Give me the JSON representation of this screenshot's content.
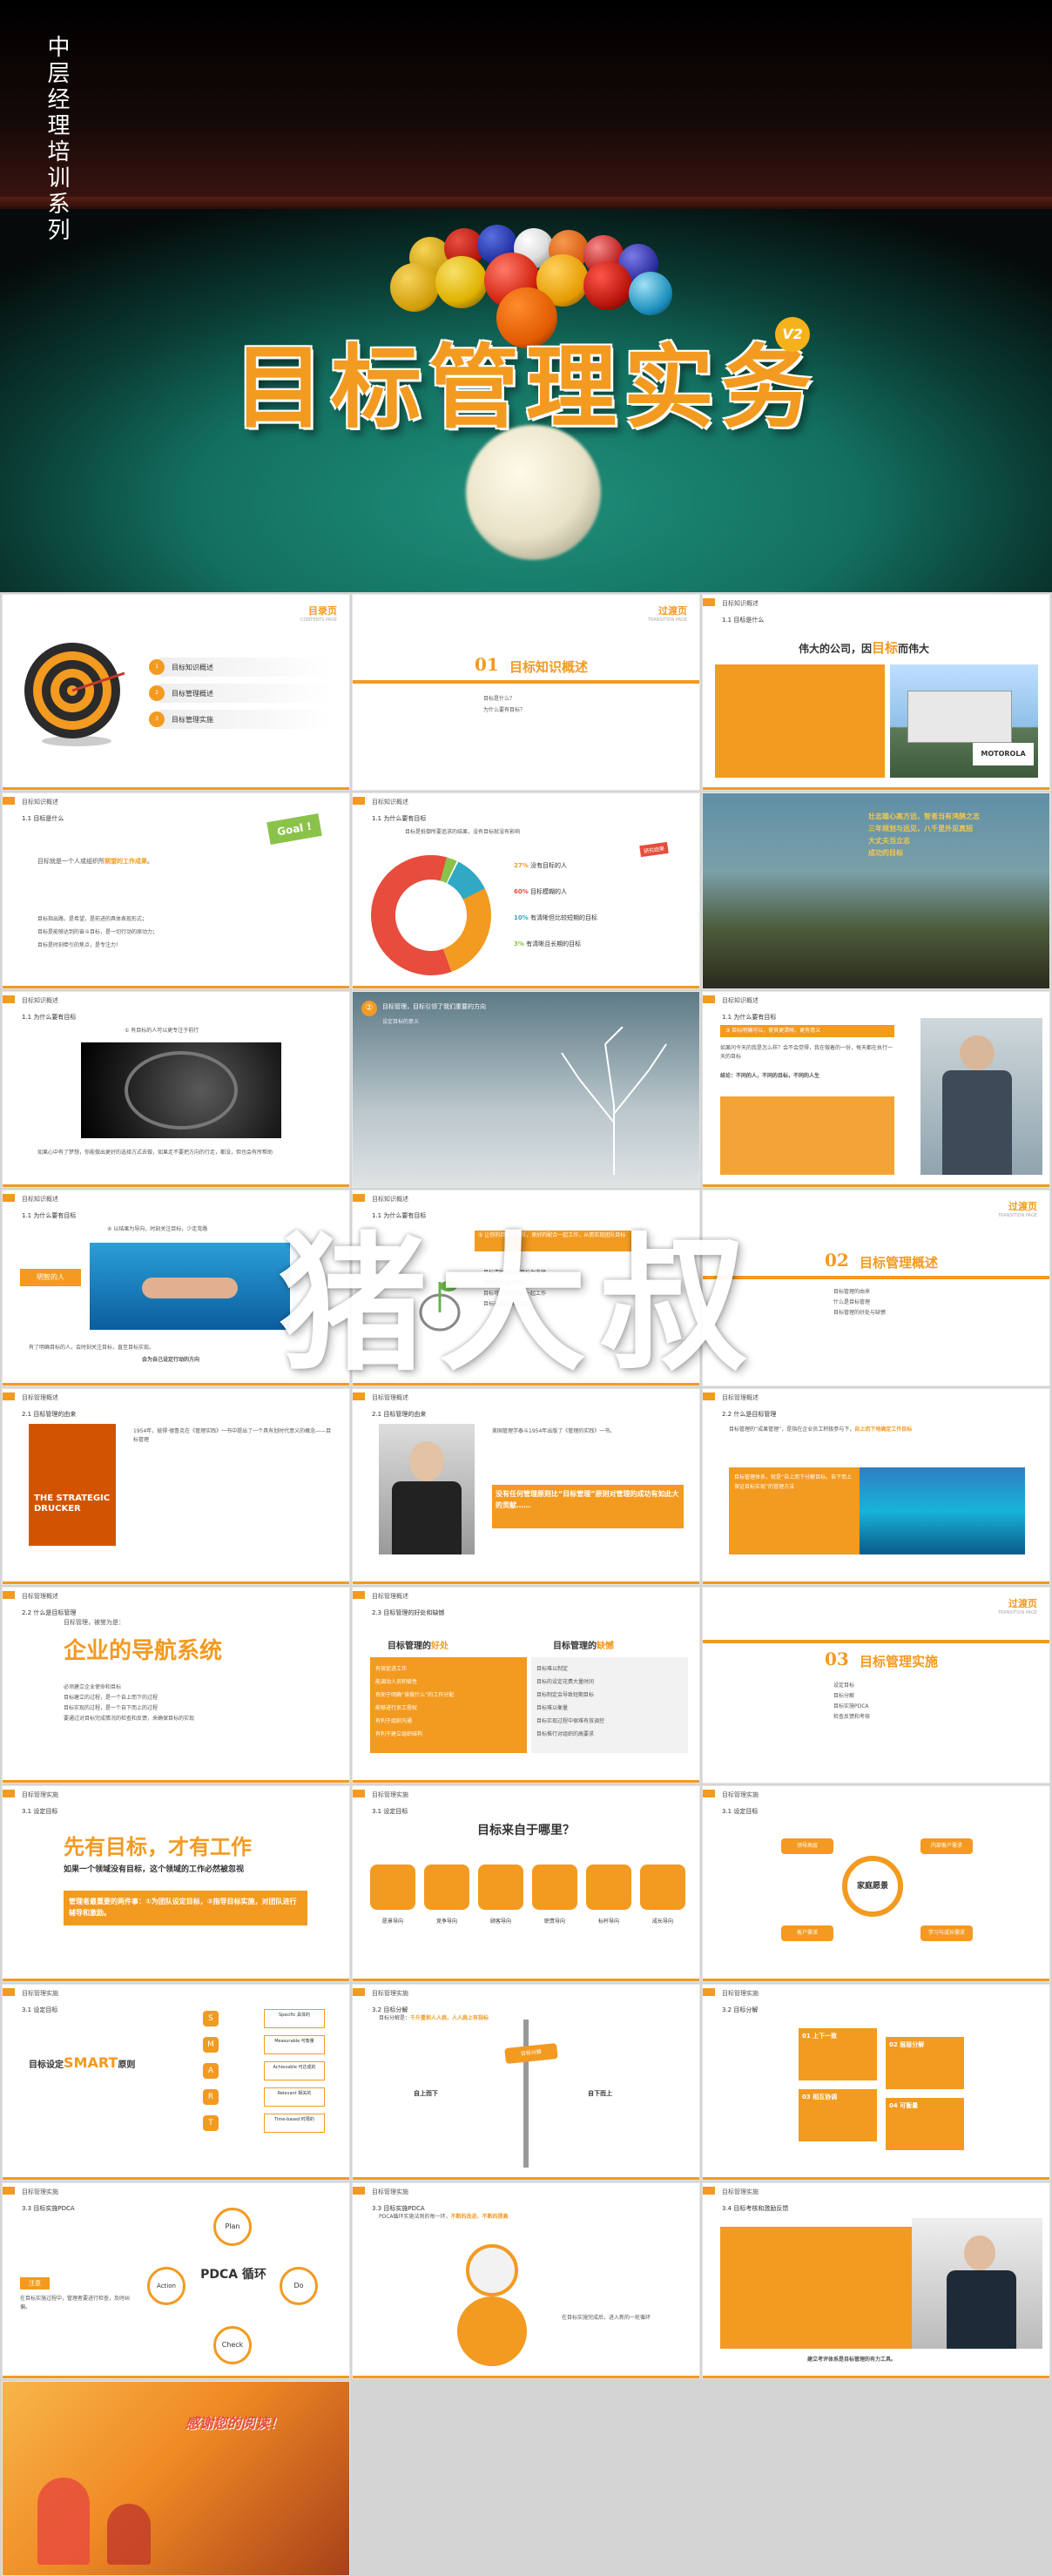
{
  "cover": {
    "series": "中层经理培训系列",
    "title": "目标管理实务",
    "badge": "V2"
  },
  "watermark": "猪大叔",
  "s1": {
    "title": "目录页",
    "subtitle": "CONTENTS PAGE",
    "items": [
      "目标知识概述",
      "目标管理概述",
      "目标管理实施"
    ],
    "nums": [
      "1",
      "2",
      "3"
    ]
  },
  "s2": {
    "title": "过渡页",
    "subtitle": "TRANSITION PAGE",
    "num": "01",
    "sec": "目标知识概述",
    "bullets": [
      "目标是什么？",
      "为什么要有目标？"
    ]
  },
  "s3": {
    "hd": "目标知识概述",
    "sub": "1.1 目标是什么",
    "headline": "伟大的公司，因",
    "hl_orange": "目标",
    "hl_end": "而伟大",
    "brand": "MOTOROLA"
  },
  "s4": {
    "hd": "目标知识概述",
    "sub": "1.1 目标是什么",
    "goal": "Goal !",
    "p1": "目标就是一个人或组织所",
    "p1o": "期望的工作成果",
    "p1e": "。",
    "items": [
      "目标指出路，是希望，是前进的具体表现形式；",
      "目标是能够达到的奋斗目标，是一切行动的原动力；",
      "目标是时刻牵引的焦点，是专注力！"
    ]
  },
  "s5": {
    "hd": "目标知识概述",
    "sub": "1.1 为什么要有目标",
    "q": "目标是抵御所要追求的结果，没有目标就没有影响",
    "tag": "研究结果",
    "pcts": [
      {
        "v": "27%",
        "t": "没有目标的人"
      },
      {
        "v": "60%",
        "t": "目标模糊的人"
      },
      {
        "v": "10%",
        "t": "有清晰但比较短期的目标"
      },
      {
        "v": "3%",
        "t": "有清晰且长期的目标"
      }
    ],
    "pie_labels": [
      "27%",
      "60%",
      "10%",
      "3%"
    ]
  },
  "s6": {
    "lines": [
      "壮志雄心高方远，智者当有鸿鹄之志",
      "三年规划与远见，八千里外见真招",
      "大丈夫当立志",
      "成功的目标"
    ]
  },
  "s7": {
    "hd": "目标知识概述",
    "sub": "1.1 为什么要有目标",
    "q": "① 有目标的人可以更专注于前行",
    "cap": "如果心中有了梦想，你能做出更好的选择方式去做，如果走不要把方向的行走，都没，但也会有所帮助"
  },
  "s8": {
    "num": "②",
    "head": "目标管理，目标引领了我们重要的方向",
    "sub": "设定目标的意义"
  },
  "s9": {
    "hd": "目标知识概述",
    "sub": "1.1 为什么要有目标",
    "q": "③ 目标明确可以，使其更清晰，更有意义",
    "p": "如果问今天的我是怎么样？会不会觉得，我在做着的一份，每天都在执行一天的目标",
    "o": "结论：不同的人，不同的目标，不同的人生"
  },
  "s10": {
    "hd": "目标知识概述",
    "sub": "1.1 为什么要有目标",
    "q": "④ 以结果为导向，时刻关注目标，少走弯路",
    "tag": "明智的人",
    "cap": "有了明确目标的人，会时刻关注目标，直至目标实现。",
    "co": "会为自己设定行动的方向"
  },
  "s11": {
    "hd": "目标知识概述",
    "sub": "1.1 为什么要有目标",
    "q": "⑤ 让你的目标与团队，更好的配合一起工作，从而实现团队目标",
    "items": [
      "目标清晰可以以目标为准绳",
      "目标可以调控绩效",
      "目标可以帮助团队一起工作",
      "目标达成团队满意度"
    ]
  },
  "s12": {
    "title": "过渡页",
    "subtitle": "TRANSITION PAGE",
    "num": "02",
    "sec": "目标管理概述",
    "bullets": [
      "目标管理的由来",
      "什么是目标管理",
      "目标管理的好处与缺憾"
    ]
  },
  "s13": {
    "hd": "目标管理概述",
    "sub": "2.1 目标管理的由来",
    "book": "THE STRATEGIC DRUCKER",
    "p": "1954年，彼得·德鲁克在《管理实践》一书中提出了一个具有划时代意义的概念——目标管理"
  },
  "s14": {
    "hd": "目标管理概述",
    "sub": "2.1 目标管理的由来",
    "p": "美国管理学泰斗1954年出版了《管理的实践》一书。",
    "o": "没有任何管理原则比“目标管理”原则对管理的成功有如此大的贡献……"
  },
  "s15": {
    "hd": "目标管理概述",
    "sub": "2.2 什么是目标管理",
    "p": "目标管理的“成果管理”，是指在企业员工积极参与下，",
    "o": "自上而下地确定工作目标",
    "box": "目标管理体系，就是“自上而下分解目标，自下而上保证目标实现”的管理方法"
  },
  "s16": {
    "hd": "目标管理概述",
    "sub": "2.2 什么是目标管理",
    "lead": "目标管理，被誉为是：",
    "big": "企业的导航系统",
    "items": [
      "必须建立企业使命和目标",
      "目标建立的过程，是一个自上而下的过程",
      "目标实现的过程，是一个自下而上的过程",
      "要通过对目标完成情况的检查和反馈，来确保目标的实现"
    ]
  },
  "s17": {
    "hd": "目标管理概述",
    "sub": "2.3 目标管理的好处和缺憾",
    "left": "目标管理的",
    "lo": "好处",
    "right": "目标管理的",
    "ro": "缺憾",
    "pros": [
      "有效促进工作",
      "能调动人员积极性",
      "有助于明确“谁做什么”的工作分配",
      "能够进行员工授权",
      "有利于组织沟通",
      "有利于建立组织结构"
    ],
    "cons": [
      "目标难以制定",
      "目标的设定花费大量时间",
      "目标制定会导致短期目标",
      "目标难以衡量",
      "目标实现过程中很难有效调控",
      "目标推行对组织的高要求"
    ]
  },
  "s18": {
    "title": "过渡页",
    "subtitle": "TRANSITION PAGE",
    "num": "03",
    "sec": "目标管理实施",
    "bullets": [
      "设定目标",
      "目标分解",
      "目标实施PDCA",
      "检查反馈和考核"
    ]
  },
  "s19": {
    "hd": "目标管理实施",
    "sub": "3.1 设定目标",
    "big": "先有目标，才有工作",
    "s": "如果一个领域没有目标，这个领域的工作必然被忽视",
    "box": "管理者最重要的两件事：①为团队设定目标，②指导目标实施，对团队进行辅导和激励。"
  },
  "s20": {
    "hd": "目标管理实施",
    "sub": "3.1 设定目标",
    "q": "目标来自于哪里？",
    "icons": [
      "愿景导向",
      "竞争导向",
      "顾客导向",
      "职责导向",
      "标杆导向",
      "成长导向"
    ]
  },
  "s21": {
    "hd": "目标管理实施",
    "sub": "3.1 设定目标",
    "center": "家庭愿景",
    "nodes": [
      "领导高层",
      "内部客户需求",
      "客户需求",
      "学习与成长需求"
    ]
  },
  "s22": {
    "hd": "目标管理实施",
    "sub": "3.1 设定目标",
    "smart": [
      "S",
      "M",
      "A",
      "R",
      "T"
    ],
    "t1": "目标设定",
    "t2": "SMART",
    "t3": "原则",
    "words": [
      "Specific 具体的",
      "Measurable 可衡量",
      "Achievable 可达成的",
      "Relevant 相关的",
      "Time-based 时限的"
    ]
  },
  "s23": {
    "hd": "目标管理实施",
    "sub": "3.2 目标分解",
    "p": "目标分解是：",
    "o": "千斤重担人人挑，人人肩上有指标",
    "sign": "目标分解",
    "b1": "自上而下",
    "b2": "自下而上"
  },
  "s24": {
    "hd": "目标管理实施",
    "sub": "3.2 目标分解",
    "steps": [
      "01 上下一致",
      "02 层层分解",
      "03 相互协调",
      "04 可衡量"
    ]
  },
  "s25": {
    "hd": "目标管理实施",
    "sub": "3.3 目标实施PDCA",
    "center": "PDCA 循环",
    "p": "Plan",
    "d": "Do",
    "c": "Check",
    "a": "Action",
    "note": "注意",
    "nt": "在目标实施过程中，管理者要进行检查，及时纠偏。"
  },
  "s26": {
    "hd": "目标管理实施",
    "sub": "3.3 目标实施PDCA",
    "p": "PDCA循环实施法则的每一环，",
    "o": "不断的改进、不断的提高",
    "lbl": "在目标实施完成后，进入新的一轮循环",
    "q": [
      "P",
      "D",
      "C",
      "A"
    ]
  },
  "s27": {
    "hd": "目标管理实施",
    "sub": "3.4 目标考核和激励反馈",
    "o": "建立考评体系是目标管理的有力工具。"
  },
  "s28": {
    "thanks": "感谢您的阅读！"
  }
}
